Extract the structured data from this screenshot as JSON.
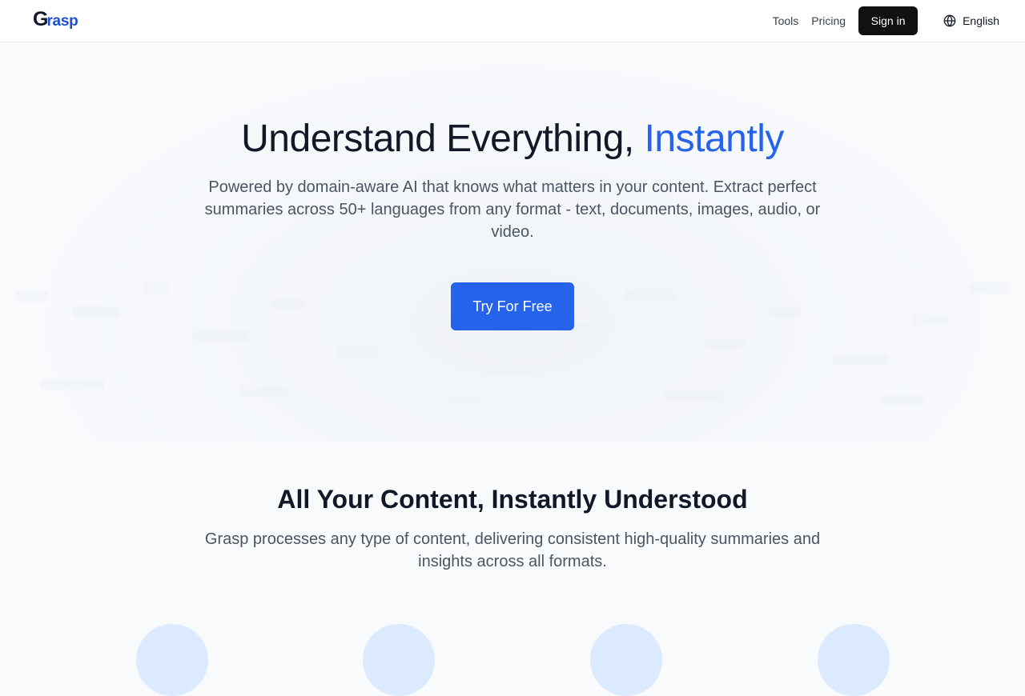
{
  "header": {
    "logo": {
      "first_letter": "G",
      "rest": "rasp"
    },
    "nav": {
      "tools": "Tools",
      "pricing": "Pricing",
      "sign_in": "Sign in",
      "language": "English"
    }
  },
  "hero": {
    "title_main": "Understand Everything, ",
    "title_accent": "Instantly",
    "subtitle": "Powered by domain-aware AI that knows what matters in your content. Extract perfect summaries across 50+ languages from any format - text, documents, images, audio, or video.",
    "cta": "Try For Free"
  },
  "features": {
    "title": "All Your Content, Instantly Understood",
    "subtitle": "Grasp processes any type of content, delivering consistent high-quality summaries and insights across all formats."
  },
  "colors": {
    "accent": "#2563eb",
    "dark_button": "#111111",
    "icon_circle": "#dbeafe"
  },
  "icons": {
    "language": "globe-icon"
  }
}
